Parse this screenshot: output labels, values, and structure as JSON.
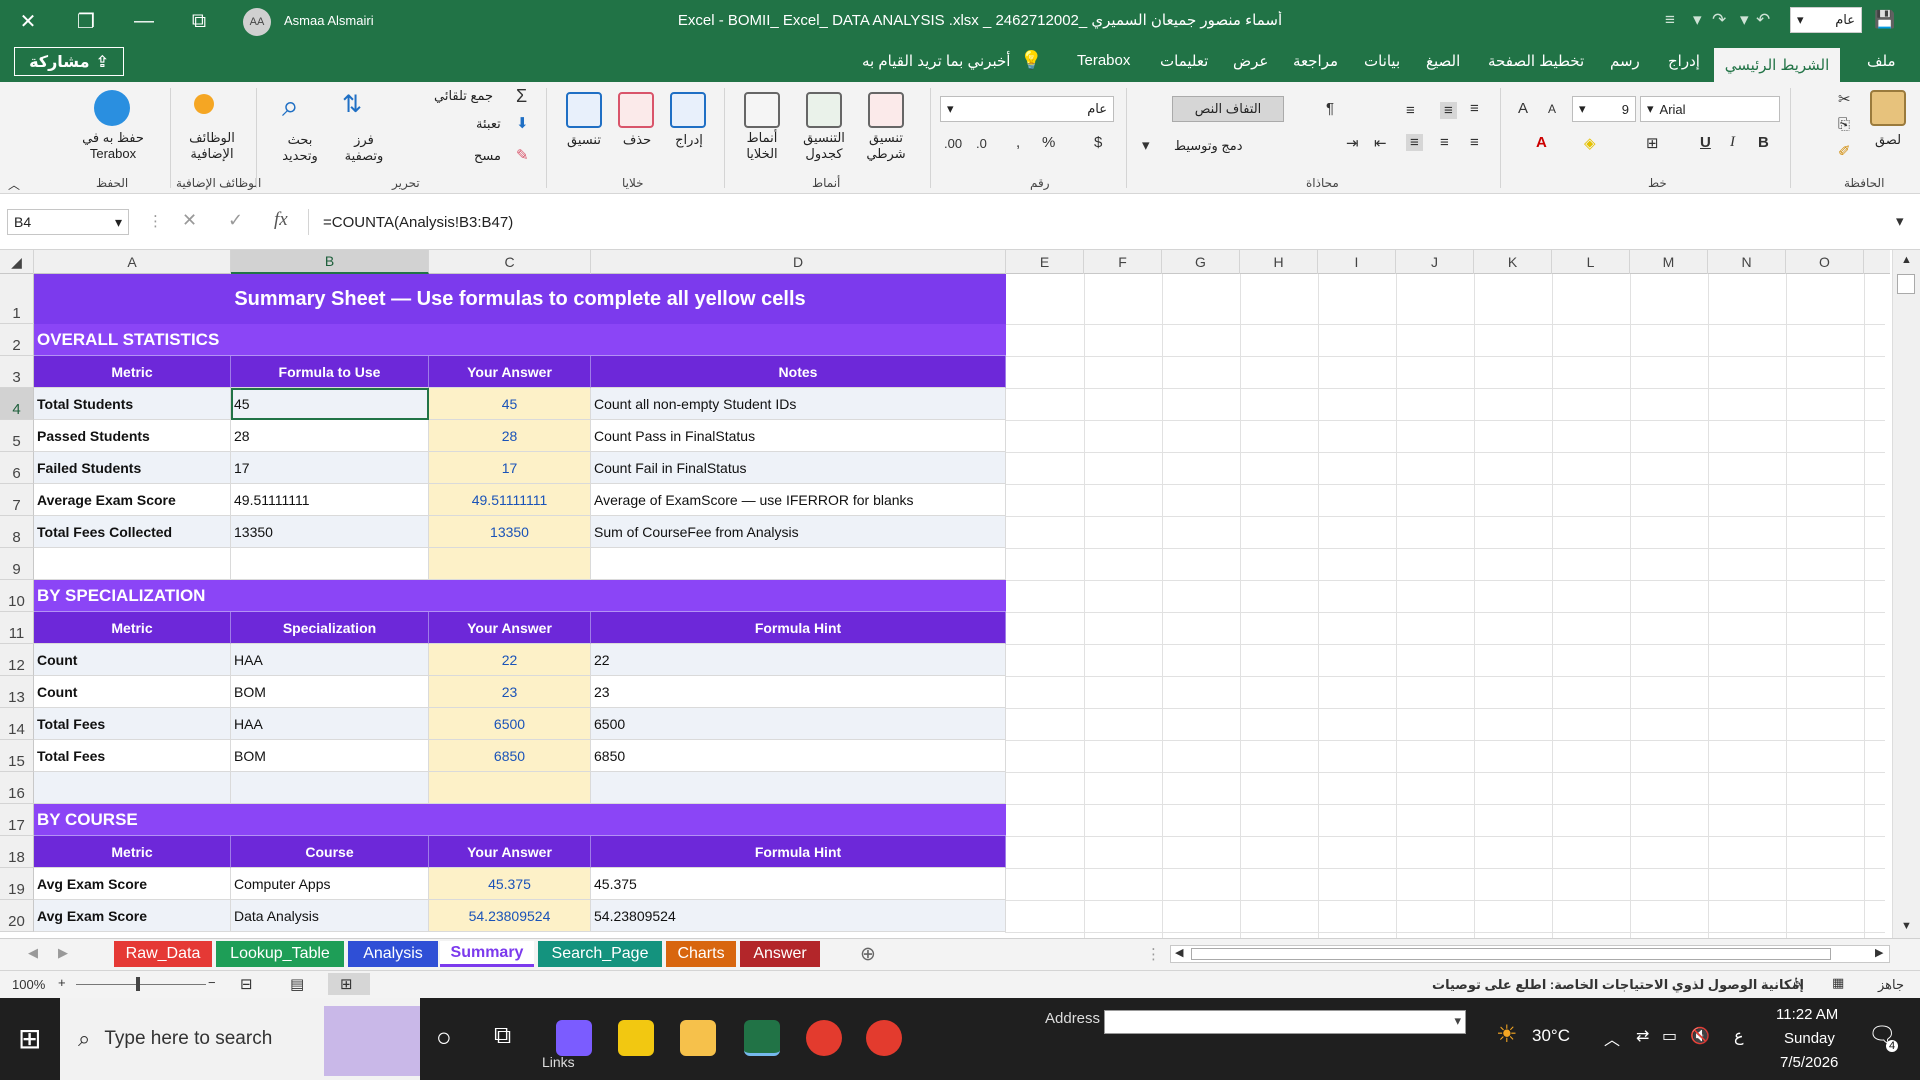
{
  "window": {
    "title": "Excel  -  BOMII_ Excel_ DATA ANALYSIS .xlsx _ أسماء منصور جميعان السميري _2462712002",
    "user_initials": "AA",
    "user_name": "Asmaa Alsmairi",
    "qat_combo_value": "عام"
  },
  "ribbon_tabs": {
    "share": "مشاركة",
    "tell_me": "أخبرني بما تريد القيام به",
    "items": [
      "Terabox",
      "تعليمات",
      "عرض",
      "مراجعة",
      "بيانات",
      "الصيغ",
      "تخطيط الصفحة",
      "رسم",
      "إدراج",
      "الشريط الرئيسي",
      "ملف"
    ],
    "active": "الشريط الرئيسي"
  },
  "ribbon": {
    "save_terabox": "حفظ به في Terabox",
    "save_group": "الحفظ",
    "addins": "الوظائف الإضافية",
    "addins_group": "الوظائف الإضافية",
    "find": "بحث وتحديد",
    "sort": "فرز وتصفية",
    "autosum": "جمع تلقائي",
    "fill": "تعبئة",
    "clear": "مسح",
    "editing_group": "تحرير",
    "format": "تنسيق",
    "delete": "حذف",
    "insert": "إدراج",
    "cells_group": "خلايا",
    "cell_styles": "أنماط الخلايا",
    "format_table": "التنسيق كجدول",
    "cond_format": "تنسيق شرطي",
    "styles_group": "أنماط",
    "number_format": "عام",
    "number_group": "رقم",
    "wrap_text": "التفاف النص",
    "merge_center": "دمج وتوسيط",
    "alignment_group": "محاذاة",
    "font_size": "9",
    "font_name": "Arial",
    "font_group": "خط",
    "paste": "لصق",
    "clipboard_group": "الحافظة"
  },
  "formula_bar": {
    "name_box": "B4",
    "formula": "=COUNTA(Analysis!B3:B47)"
  },
  "grid": {
    "columns": [
      "A",
      "B",
      "C",
      "D",
      "E",
      "F",
      "G",
      "H",
      "I",
      "J",
      "K",
      "L",
      "M",
      "N",
      "O"
    ],
    "rows": [
      "1",
      "2",
      "3",
      "4",
      "5",
      "6",
      "7",
      "8",
      "9",
      "10",
      "11",
      "12",
      "13",
      "14",
      "15",
      "16",
      "17",
      "18",
      "19",
      "20"
    ],
    "banner": "Summary Sheet — Use formulas to complete all yellow cells",
    "sections": {
      "overall": "OVERALL STATISTICS",
      "by_spec": "BY SPECIALIZATION",
      "by_course": "BY COURSE"
    },
    "headers_overall": [
      "Metric",
      "Formula to Use",
      "Your Answer",
      "Notes"
    ],
    "headers_spec": [
      "Metric",
      "Specialization",
      "Your Answer",
      "Formula Hint"
    ],
    "headers_course": [
      "Metric",
      "Course",
      "Your Answer",
      "Formula Hint"
    ],
    "overall_rows": [
      {
        "metric": "Total Students",
        "formula": "45",
        "answer": "45",
        "note": "Count all non-empty Student IDs"
      },
      {
        "metric": "Passed Students",
        "formula": "28",
        "answer": "28",
        "note": "Count Pass in FinalStatus"
      },
      {
        "metric": "Failed Students",
        "formula": "17",
        "answer": "17",
        "note": "Count Fail in FinalStatus"
      },
      {
        "metric": "Average Exam Score",
        "formula": "49.51111111",
        "answer": "49.51111111",
        "note": "Average of ExamScore — use IFERROR for blanks"
      },
      {
        "metric": "Total Fees Collected",
        "formula": "13350",
        "answer": "13350",
        "note": "Sum of CourseFee from Analysis"
      }
    ],
    "spec_rows": [
      {
        "metric": "Count",
        "spec": "HAA",
        "answer": "22",
        "hint": "22"
      },
      {
        "metric": "Count",
        "spec": "BOM",
        "answer": "23",
        "hint": "23"
      },
      {
        "metric": "Total Fees",
        "spec": "HAA",
        "answer": "6500",
        "hint": "6500"
      },
      {
        "metric": "Total Fees",
        "spec": "BOM",
        "answer": "6850",
        "hint": "6850"
      }
    ],
    "course_rows": [
      {
        "metric": "Avg Exam Score",
        "course": "Computer Apps",
        "answer": "45.375",
        "hint": "45.375"
      },
      {
        "metric": "Avg Exam Score",
        "course": "Data Analysis",
        "answer": "54.23809524",
        "hint": "54.23809524"
      }
    ]
  },
  "sheet_tabs": [
    {
      "name": "Raw_Data",
      "color": "#e53935"
    },
    {
      "name": "Lookup_Table",
      "color": "#1e9e57"
    },
    {
      "name": "Analysis",
      "color": "#2f4fd6"
    },
    {
      "name": "Summary",
      "color": "#7c3aed"
    },
    {
      "name": "Search_Page",
      "color": "#14937e"
    },
    {
      "name": "Charts",
      "color": "#d8660f"
    },
    {
      "name": "Answer",
      "color": "#b3262a"
    }
  ],
  "status": {
    "zoom": "100%",
    "ready": "جاهز",
    "accessibility": "إمكانية الوصول لذوي الاحتياجات الخاصة: اطلع على توصيات"
  },
  "taskbar": {
    "search_placeholder": "Type here to search",
    "links": "Links",
    "address_label": "Address",
    "temperature": "30°C",
    "time": "11:22 AM",
    "day": "Sunday",
    "date": "7/5/2026",
    "lang": "ع",
    "notif_count": "4"
  },
  "colors": {
    "excel_green": "#217346",
    "purple_banner": "#7c3aed",
    "purple_header": "#6d28d9",
    "answer_yellow": "#fdf1c8"
  }
}
